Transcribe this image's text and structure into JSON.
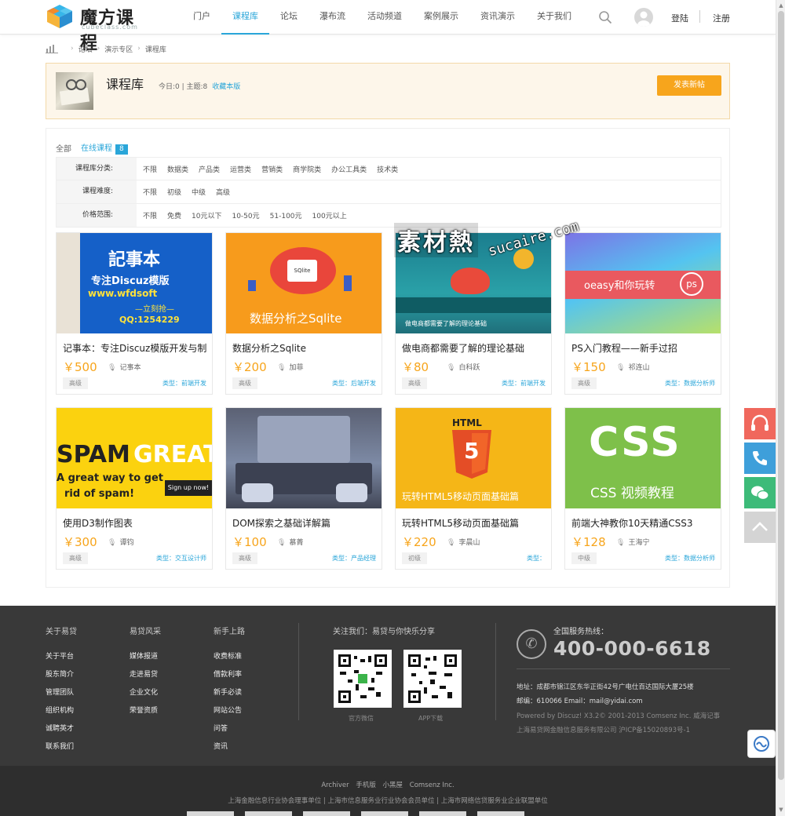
{
  "header": {
    "logo_text": "魔方课程",
    "logo_sub": "cubeclass.com",
    "nav": [
      {
        "label": "门户",
        "active": false
      },
      {
        "label": "课程库",
        "active": true
      },
      {
        "label": "论坛",
        "active": false
      },
      {
        "label": "瀑布流",
        "active": false
      },
      {
        "label": "活动频道",
        "active": false
      },
      {
        "label": "案例展示",
        "active": false
      },
      {
        "label": "资讯演示",
        "active": false
      },
      {
        "label": "关于我们",
        "active": false
      }
    ],
    "login_label": "登陆",
    "register_label": "注册"
  },
  "breadcrumb": [
    "论坛",
    "演示专区",
    "课程库"
  ],
  "forum": {
    "title": "课程库",
    "stats": "今日:0 | 主题:8",
    "favorite_label": "收藏本版",
    "post_button": "发表新帖"
  },
  "tabs": {
    "all_label": "全部",
    "online_label": "在线课程",
    "online_count": "8"
  },
  "filters": [
    {
      "label": "课程库分类:",
      "options": [
        "不限",
        "数据类",
        "产品类",
        "运营类",
        "营销类",
        "商学院类",
        "办公工具类",
        "技术类"
      ]
    },
    {
      "label": "课程难度:",
      "options": [
        "不限",
        "初级",
        "中级",
        "高级"
      ]
    },
    {
      "label": "价格范围:",
      "options": [
        "不限",
        "免费",
        "10元以下",
        "10-50元",
        "51-100元",
        "100元以上"
      ]
    }
  ],
  "courses": [
    {
      "title": "记事本：专注Discuz模版开发与制",
      "price": "￥500",
      "teacher": "记事本",
      "level": "高级",
      "type": "类型：前端开发",
      "image": "notepad-banner",
      "img_lines": [
        "記事本",
        "专注Discuz模版",
        "www.wfdsoft",
        "—立刻抢—",
        "QQ:1254229"
      ]
    },
    {
      "title": "数据分析之Sqlite",
      "price": "￥200",
      "teacher": "加菲",
      "level": "高级",
      "type": "类型：后端开发",
      "image": "sqlite-banner",
      "img_lines": [
        "数据分析之Sqlite",
        "SQlite"
      ]
    },
    {
      "title": "做电商都需要了解的理论基础",
      "price": "￥80",
      "teacher": "白科跃",
      "level": "高级",
      "type": "类型：前端开发",
      "image": "ecommerce-banner",
      "img_lines": [
        "做电商都需要了解的理论基础"
      ]
    },
    {
      "title": "PS入门教程——新手过招",
      "price": "￥150",
      "teacher": "祁连山",
      "level": "高级",
      "type": "类型：数据分析师",
      "image": "ps-banner",
      "img_lines": [
        "oeasy和你玩转",
        "ps"
      ]
    },
    {
      "title": "使用D3制作图表",
      "price": "￥300",
      "teacher": "谭钧",
      "level": "高级",
      "type": "类型：交互设计师",
      "image": "spam-banner",
      "img_lines": [
        "SPAM",
        "GREAT",
        "A great way to get",
        "rid of spam!",
        "Sign up now!"
      ]
    },
    {
      "title": "DOM探索之基础详解篇",
      "price": "￥100",
      "teacher": "慕菁",
      "level": "高级",
      "type": "类型：产品经理",
      "image": "dom-banner",
      "img_lines": []
    },
    {
      "title": "玩转HTML5移动页面基础篇",
      "price": "￥220",
      "teacher": "李晨山",
      "level": "初级",
      "type": "类型：",
      "image": "html5-banner",
      "img_lines": [
        "HTML",
        "5",
        "玩转HTML5移动页面基础篇"
      ]
    },
    {
      "title": "前端大神教你10天精通CSS3",
      "price": "￥128",
      "teacher": "王海宁",
      "level": "中级",
      "type": "类型：数据分析师",
      "image": "css-banner",
      "img_lines": [
        "CSS",
        "CSS 视频教程"
      ]
    }
  ],
  "footer": {
    "columns": [
      {
        "title": "关于易贷",
        "links": [
          "关于平台",
          "股东简介",
          "管理团队",
          "组织机构",
          "诚聘英才",
          "联系我们"
        ]
      },
      {
        "title": "易贷风采",
        "links": [
          "媒体报道",
          "走进易贷",
          "企业文化",
          "荣誉资质"
        ]
      },
      {
        "title": "新手上路",
        "links": [
          "收费标准",
          "借款利率",
          "新手必读",
          "网站公告",
          "问答",
          "资讯"
        ]
      }
    ],
    "follow_label": "关注我们：易贷与你快乐分享",
    "qr_captions": [
      "官方微信",
      "APP下载"
    ],
    "hotline_label": "全国服务热线：",
    "hotline": "400-000-6618",
    "address": "地址：成都市锦江区东华正街42号广电仕百达国际大厦25楼",
    "postcode_email": "邮编：610066 Email：mail@yidai.com",
    "powered": "Powered by Discuz! X3.2© 2001-2013 Comsenz Inc.  威海记事",
    "icp": "上海易贷网金融信息服务有限公司  沪ICP备15020893号-1",
    "bottom_links": [
      "Archiver",
      "手机版",
      "小黑屋",
      "Comsenz Inc."
    ],
    "units": "上海金融信息行业协会理事单位 | 上海市信息服务业行业协会会员单位 | 上海市网络信贷服务业企业联盟单位"
  },
  "watermark": {
    "cn": "素材熱",
    "en": "sucaire.com"
  },
  "colors": {
    "accent": "#2aa6d9",
    "orange": "#f7a51c",
    "footer_bg": "#393939",
    "side_red": "#f0685d",
    "side_blue": "#3e9fda",
    "side_green": "#3dbb79"
  }
}
